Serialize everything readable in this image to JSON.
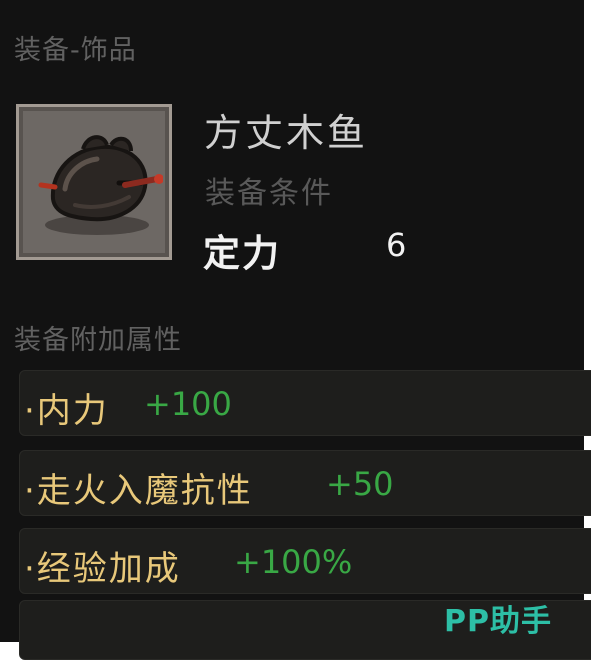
{
  "header": {
    "section_title": "装备-饰品"
  },
  "item": {
    "icon": "wooden-fish-icon",
    "name": "方丈木鱼",
    "condition_title": "装备条件",
    "requirement_label": "定力",
    "requirement_value": "6"
  },
  "attributes": {
    "title": "装备附加属性",
    "rows": [
      {
        "name": "·内力",
        "value": "+100"
      },
      {
        "name": "·走火入魔抗性",
        "value": "+50"
      },
      {
        "name": "·经验加成",
        "value": "+100%"
      }
    ]
  },
  "watermark": "PP助手",
  "colors": {
    "panel_bg": "#121212",
    "attr_name": "#e8c87a",
    "attr_value": "#39a845",
    "muted_text": "#616161",
    "watermark": "#2dbfa6"
  }
}
